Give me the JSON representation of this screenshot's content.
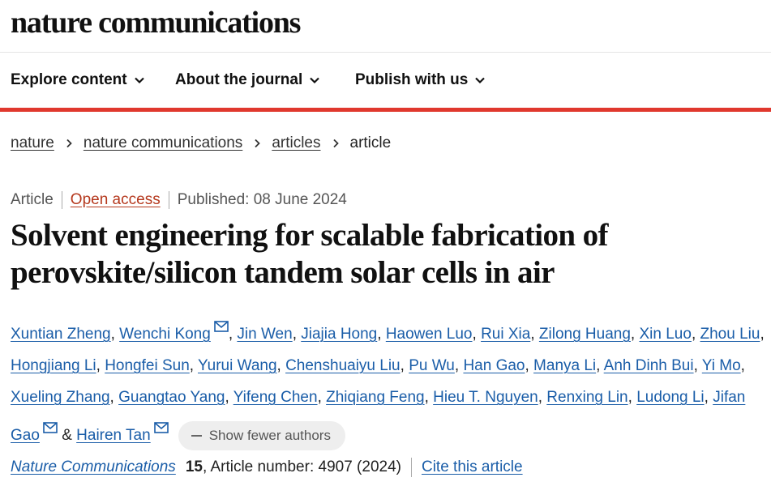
{
  "site": {
    "logo": "nature communications"
  },
  "nav": [
    {
      "label": "Explore content",
      "icon": "chevron-down-icon"
    },
    {
      "label": "About the journal",
      "icon": "chevron-down-icon"
    },
    {
      "label": "Publish with us",
      "icon": "chevron-down-icon"
    }
  ],
  "breadcrumb": [
    "nature",
    "nature communications",
    "articles",
    "article"
  ],
  "meta": {
    "type": "Article",
    "access": "Open access",
    "published": "Published: 08 June 2024"
  },
  "title": "Solvent engineering for scalable fabrication of perovskite/silicon tandem solar cells in air",
  "authors": [
    "Xuntian Zheng",
    "Wenchi Kong",
    "Jin Wen",
    "Jiajia Hong",
    "Haowen Luo",
    "Rui Xia",
    "Zilong Huang",
    "Xin Luo",
    "Zhou Liu",
    "Hongjiang Li",
    "Hongfei Sun",
    "Yurui Wang",
    "Chenshuaiyu Liu",
    "Pu Wu",
    "Han Gao",
    "Manya Li",
    "Anh Dinh Bui",
    "Yi Mo",
    "Xueling Zhang",
    "Guangtao Yang",
    "Yifeng Chen",
    "Zhiqiang Feng",
    "Hieu T. Nguyen",
    "Renxing Lin",
    "Ludong Li",
    "Jifan Gao",
    "Hairen Tan"
  ],
  "corresponding": [
    "Wenchi Kong",
    "Jifan Gao",
    "Hairen Tan"
  ],
  "authors_sep": ", ",
  "authors_last_sep": " & ",
  "show_fewer": "Show fewer authors",
  "citation": {
    "journal": "Nature Communications",
    "volume": "15",
    "article_number": ", Article number: 4907 (2024)",
    "cite": "Cite this article"
  },
  "colors": {
    "accent_red": "#e0382e",
    "link_blue": "#1a5da8",
    "open_access": "#b5381d"
  }
}
